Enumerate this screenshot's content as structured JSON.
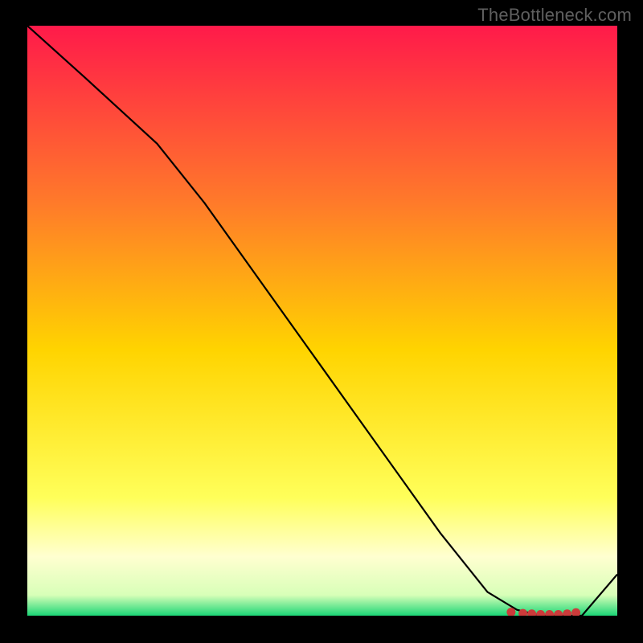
{
  "attribution": "TheBottleneck.com",
  "colors": {
    "frame": "#000000",
    "line": "#000000",
    "marker": "#cc3b3b",
    "text": "#5f5f5f"
  },
  "chart_data": {
    "type": "line",
    "title": "",
    "xlabel": "",
    "ylabel": "",
    "xlim": [
      0,
      100
    ],
    "ylim": [
      0,
      100
    ],
    "gradient_stops": [
      {
        "offset": 0.0,
        "color": "#ff1a4a"
      },
      {
        "offset": 0.3,
        "color": "#ff7a2a"
      },
      {
        "offset": 0.55,
        "color": "#ffd400"
      },
      {
        "offset": 0.8,
        "color": "#ffff5a"
      },
      {
        "offset": 0.9,
        "color": "#ffffd0"
      },
      {
        "offset": 0.965,
        "color": "#d8ffb8"
      },
      {
        "offset": 1.0,
        "color": "#1bd676"
      }
    ],
    "series": [
      {
        "name": "curve",
        "x": [
          0,
          10,
          22,
          30,
          40,
          50,
          60,
          70,
          78,
          83,
          87,
          91,
          94,
          100
        ],
        "y": [
          100,
          91,
          80,
          70,
          56,
          42,
          28,
          14,
          4,
          1,
          0,
          0,
          0,
          7
        ]
      }
    ],
    "markers": {
      "x": [
        82,
        84,
        85.5,
        87,
        88.5,
        90,
        91.5,
        93
      ],
      "y": [
        0.6,
        0.4,
        0.3,
        0.2,
        0.2,
        0.2,
        0.3,
        0.5
      ]
    }
  }
}
